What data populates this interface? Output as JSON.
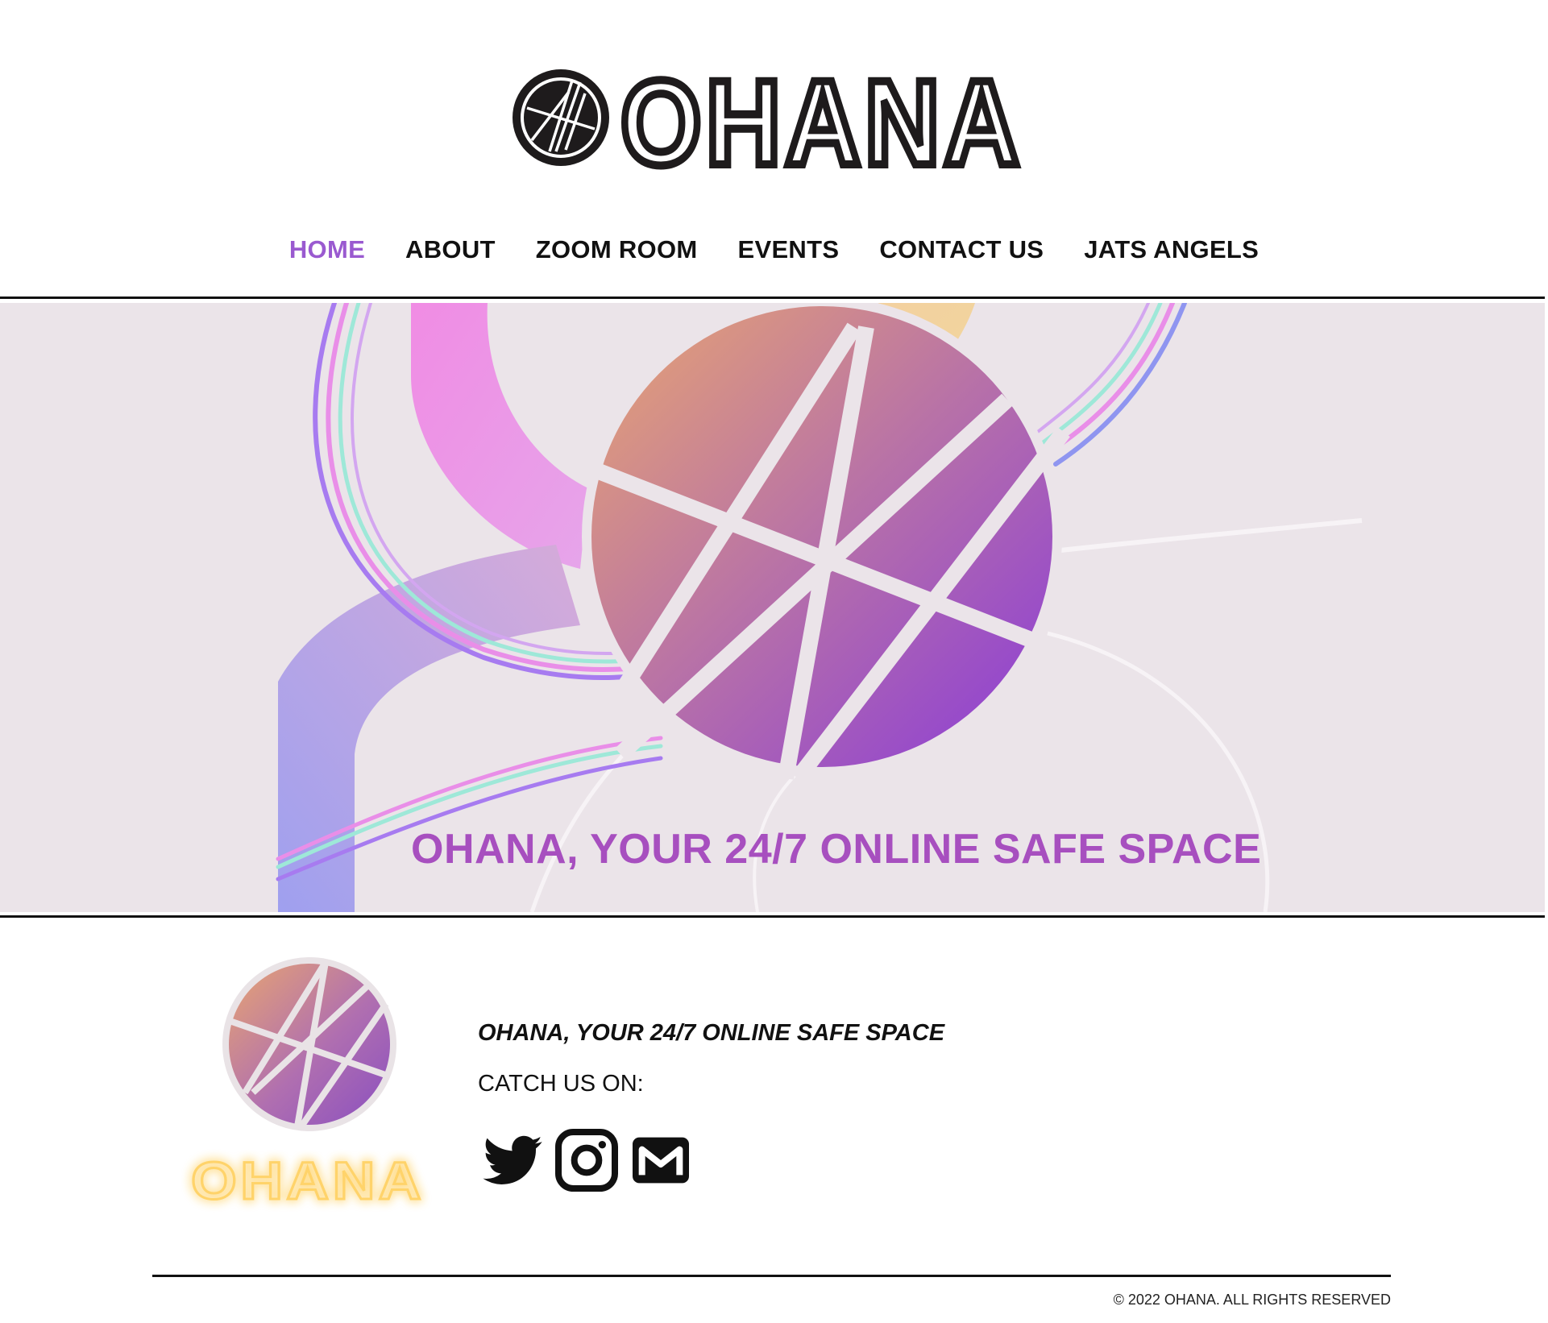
{
  "header": {
    "logo_text": "OHANA"
  },
  "nav": {
    "items": [
      {
        "label": "HOME",
        "active": true
      },
      {
        "label": "ABOUT",
        "active": false
      },
      {
        "label": "ZOOM ROOM",
        "active": false
      },
      {
        "label": "EVENTS",
        "active": false
      },
      {
        "label": "CONTACT US",
        "active": false
      },
      {
        "label": "JATS ANGELS",
        "active": false
      }
    ]
  },
  "hero": {
    "title": "OHANA, YOUR 24/7 ONLINE SAFE SPACE"
  },
  "footer": {
    "wordmark": "OHANA",
    "tagline": "OHANA, YOUR 24/7 ONLINE SAFE SPACE",
    "catch_label": "CATCH US ON:",
    "social": [
      {
        "icon": "twitter-icon"
      },
      {
        "icon": "instagram-icon"
      },
      {
        "icon": "gmail-icon"
      }
    ],
    "copyright": "© 2022 OHANA. ALL RIGHTS RESERVED"
  },
  "colors": {
    "accent": "#9a5ad0",
    "hero_bg": "#ebe4e9",
    "hero_title": "#a74fbf",
    "text": "#111111",
    "neon": "#ffd36a"
  }
}
